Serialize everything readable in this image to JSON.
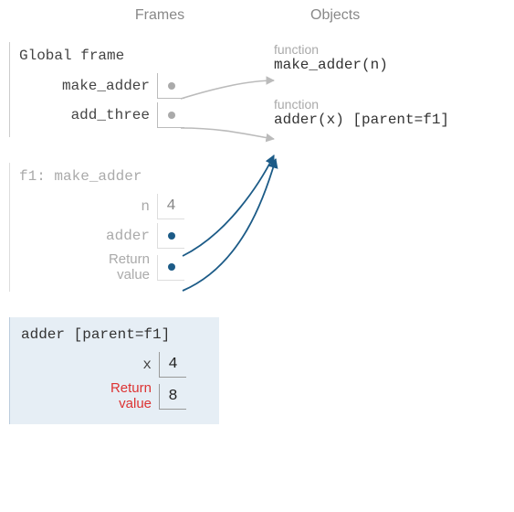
{
  "headers": {
    "frames": "Frames",
    "objects": "Objects"
  },
  "global_frame": {
    "title": "Global frame",
    "rows": [
      {
        "label": "make_adder",
        "ptr": true
      },
      {
        "label": "add_three",
        "ptr": true
      }
    ]
  },
  "f1_frame": {
    "title": "f1: make_adder",
    "rows": [
      {
        "label": "n",
        "value": "4"
      },
      {
        "label": "adder",
        "ptr": true,
        "blue": true
      },
      {
        "label": "Return\nvalue",
        "nonmono": true,
        "ptr": true,
        "blue": true
      }
    ]
  },
  "active_frame": {
    "title": "adder [parent=f1]",
    "rows": [
      {
        "label": "x",
        "value": "4"
      },
      {
        "label": "Return\nvalue",
        "nonmono": true,
        "return": true,
        "value": "8"
      }
    ]
  },
  "objects": [
    {
      "kind": "function",
      "sig": "make_adder(n)"
    },
    {
      "kind": "function",
      "sig": "adder(x) [parent=f1]"
    }
  ]
}
